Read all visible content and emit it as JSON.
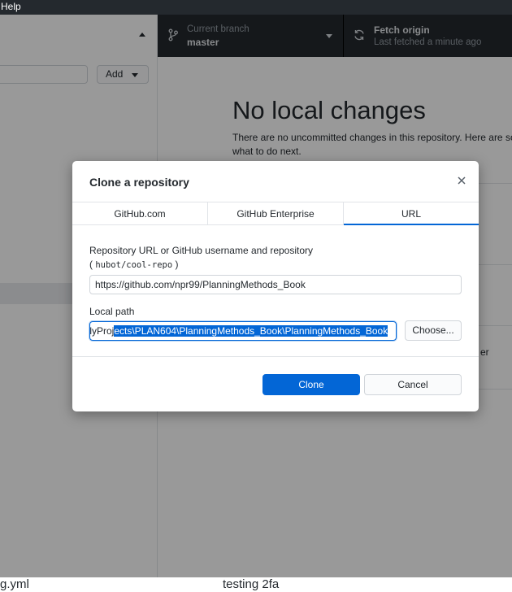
{
  "menubar": {
    "help_label": "Help"
  },
  "toolbar": {
    "branch_title": "Current branch",
    "branch_name": "master",
    "fetch_title": "Fetch origin",
    "fetch_sub": "Last fetched a minute ago"
  },
  "sidebar": {
    "add_label": "Add"
  },
  "main": {
    "title": "No local changes",
    "description": "There are no uncommitted changes in this repository. Here are so what to do next.",
    "card_fragment": "er"
  },
  "bottom": {
    "left_text": "g.yml",
    "right_text": "testing 2fa"
  },
  "dialog": {
    "title": "Clone a repository",
    "tabs": [
      {
        "label": "GitHub.com",
        "active": false
      },
      {
        "label": "GitHub Enterprise",
        "active": false
      },
      {
        "label": "URL",
        "active": true
      }
    ],
    "url_label": "Repository URL or GitHub username and repository",
    "url_hint_open": "(",
    "url_hint_code": "hubot/cool-repo",
    "url_hint_close": ")",
    "url_value": "https://github.com/npr99/PlanningMethods_Book",
    "path_label": "Local path",
    "path_prefix": "/lyProj",
    "path_selected": "ects\\PLAN604\\PlanningMethods_Book\\PlanningMethods_Book",
    "choose_label": "Choose...",
    "clone_label": "Clone",
    "cancel_label": "Cancel"
  },
  "colors": {
    "accent": "#0366d6",
    "toolbar_bg": "#24292e",
    "overlay": "rgba(0,0,0,0.40)"
  }
}
